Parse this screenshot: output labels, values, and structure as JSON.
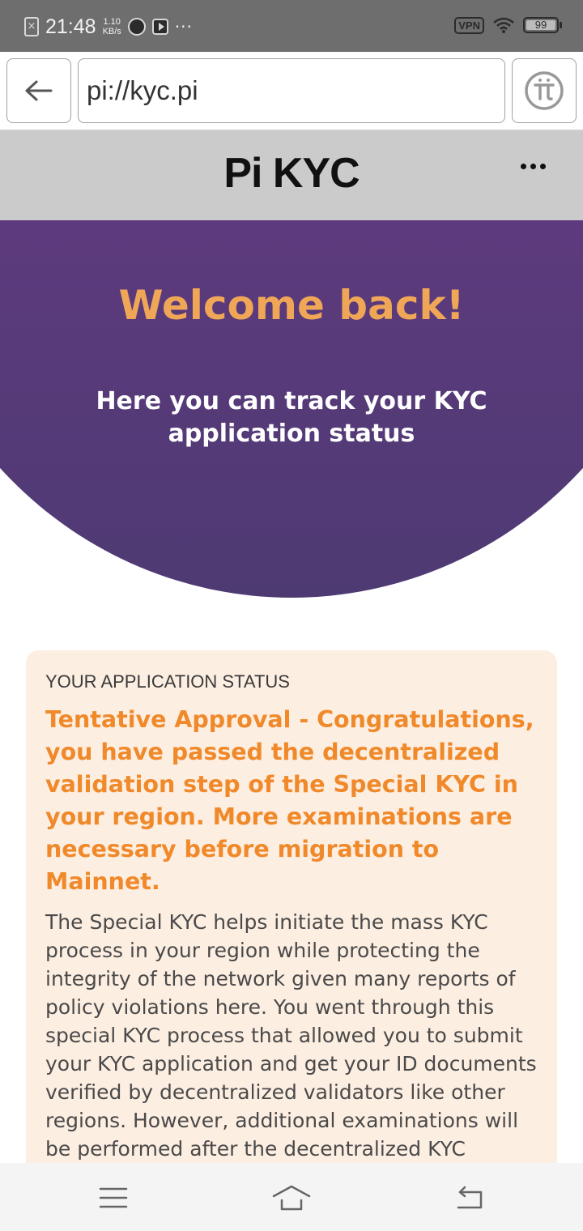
{
  "statusbar": {
    "time": "21:48",
    "speed_value": "1.10",
    "speed_unit": "KB/s",
    "more": "···",
    "vpn": "VPN",
    "battery": "99",
    "battery_level": 0.99
  },
  "browser": {
    "url": "pi://kyc.pi",
    "back_icon": "arrow-left-icon",
    "pi_icon": "pi-logo-icon"
  },
  "app": {
    "title": "Pi KYC",
    "menu_icon": "more-dots-icon"
  },
  "hero": {
    "welcome": "Welcome back!",
    "subtitle": "Here you can track your KYC application status"
  },
  "status_card": {
    "label": "YOUR APPLICATION STATUS",
    "status": "Tentative Approval - Congratulations, you have passed the decentralized validation step of the Special KYC in your region. More examinations are necessary before migration to Mainnet.",
    "body": "The Special KYC helps initiate the mass KYC process in your region while protecting the integrity of the network given many reports of policy violations here. You went through this special KYC process that allowed you to submit your KYC application and get your ID documents verified by decentralized validators like other regions. However, additional examinations will be performed after the decentralized KYC approval before your"
  },
  "navbar": {
    "menu_icon": "menu-icon",
    "home_icon": "home-icon",
    "back_icon": "back-icon"
  },
  "colors": {
    "hero_purple": "#5e3a7e",
    "welcome_orange": "#efa657",
    "status_orange": "#f0892a",
    "card_bg": "#fdeee2"
  }
}
